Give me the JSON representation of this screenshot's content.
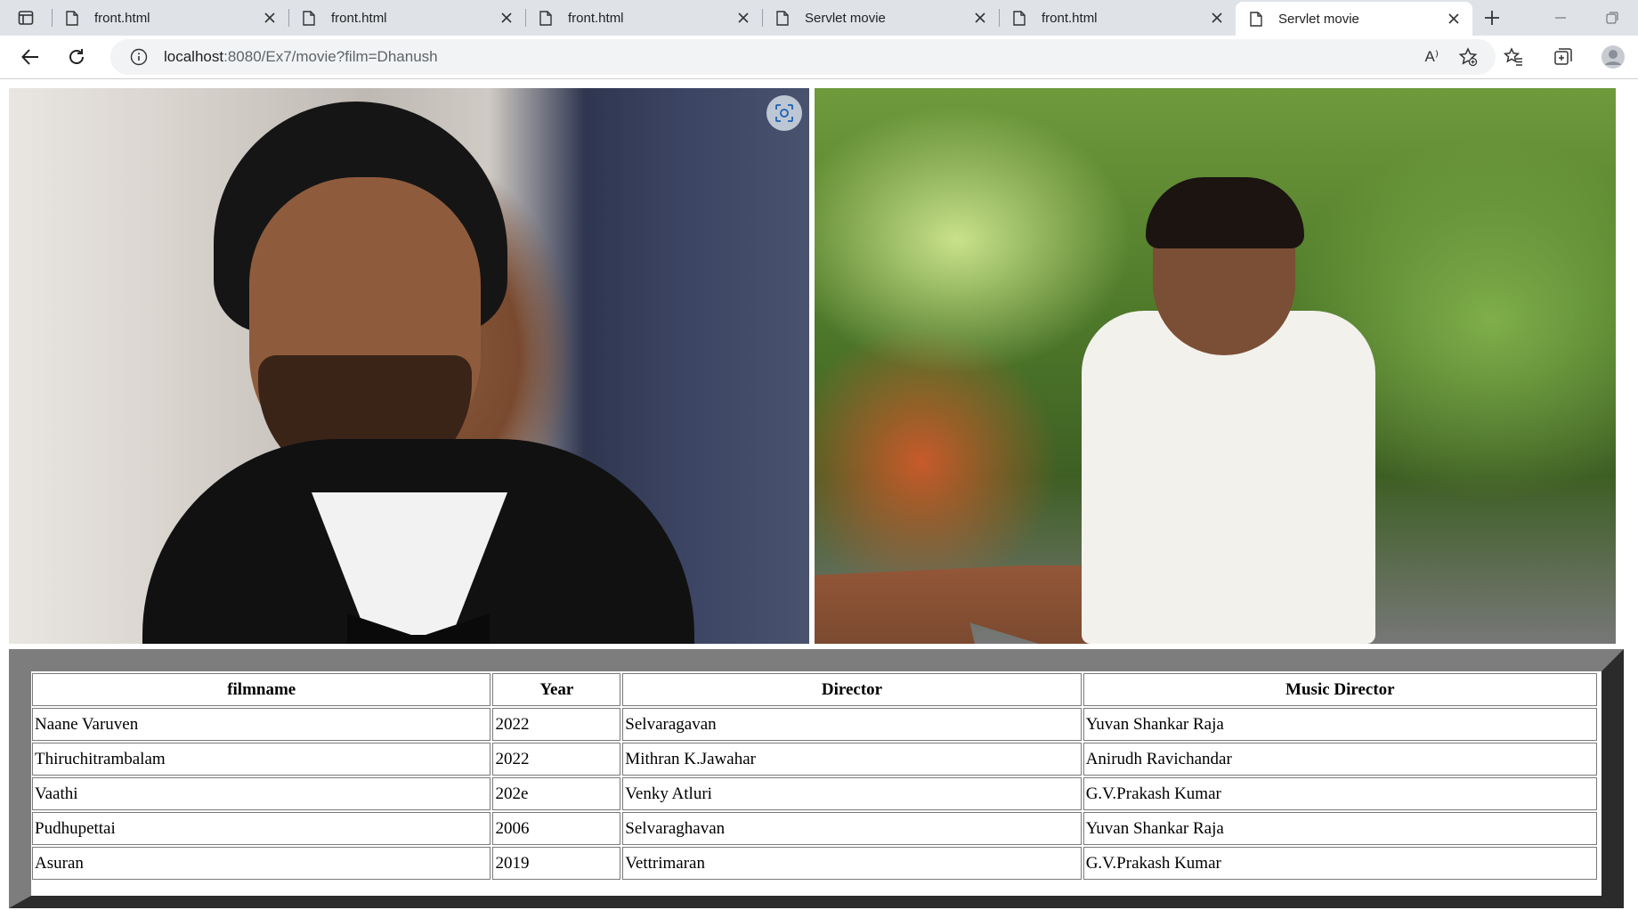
{
  "browser": {
    "tabs": [
      {
        "title": "front.html",
        "active": false
      },
      {
        "title": "front.html",
        "active": false
      },
      {
        "title": "front.html",
        "active": false
      },
      {
        "title": "Servlet movie",
        "active": false
      },
      {
        "title": "front.html",
        "active": false
      },
      {
        "title": "Servlet movie",
        "active": true
      }
    ],
    "url_host": "localhost",
    "url_rest": ":8080/Ex7/movie?film=Dhanush",
    "read_aloud_label": "A⁾"
  },
  "page": {
    "photos": [
      {
        "icon": "portrait-photo-suit"
      },
      {
        "icon": "portrait-photo-garden"
      }
    ],
    "table": {
      "headers": [
        "filmname",
        "Year",
        "Director",
        "Music Director"
      ],
      "rows": [
        [
          "Naane Varuven",
          "2022",
          "Selvaragavan",
          "Yuvan Shankar Raja"
        ],
        [
          "Thiruchitrambalam",
          "2022",
          "Mithran K.Jawahar",
          "Anirudh Ravichandar"
        ],
        [
          "Vaathi",
          "202e",
          "Venky Atluri",
          "G.V.Prakash Kumar"
        ],
        [
          "Pudhupettai",
          "2006",
          "Selvaraghavan",
          "Yuvan Shankar Raja"
        ],
        [
          "Asuran",
          "2019",
          "Vettrimaran",
          "G.V.Prakash Kumar"
        ]
      ]
    }
  },
  "colors": {
    "tabstrip": "#dfe3e8",
    "table_border_light": "#7d7d7d",
    "table_border_dark": "#2b2b2b"
  }
}
